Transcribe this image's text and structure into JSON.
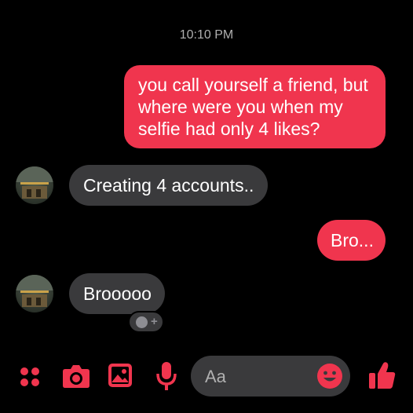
{
  "chat": {
    "timestamp": "10:10 PM",
    "messages": [
      {
        "direction": "outgoing",
        "text": "you call yourself a friend, but where were you when my selfie had only 4 likes?"
      },
      {
        "direction": "incoming",
        "text": "Creating 4 accounts.."
      },
      {
        "direction": "outgoing",
        "text": "Bro..."
      },
      {
        "direction": "incoming",
        "text": "Brooooo"
      }
    ]
  },
  "composer": {
    "placeholder": "Aa",
    "icons": [
      "menu-dots-icon",
      "camera-icon",
      "image-icon",
      "microphone-icon",
      "emoji-icon",
      "thumbs-up-icon"
    ]
  },
  "colors": {
    "accent": "#f0354e",
    "incoming_bubble": "#3a3a3c",
    "background": "#000000"
  }
}
